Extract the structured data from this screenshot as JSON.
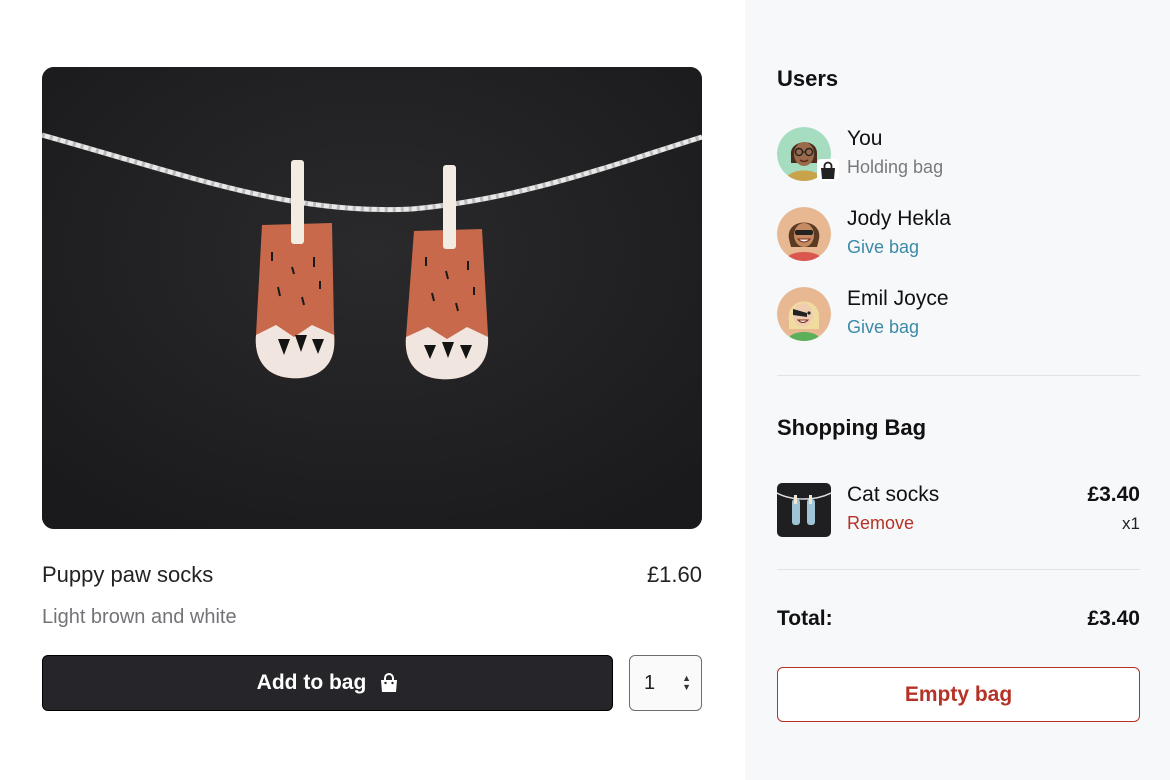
{
  "product": {
    "name": "Puppy paw socks",
    "price": "£1.60",
    "description": "Light brown and white",
    "image_icon": "socks-on-clothesline-image",
    "add_label": "Add to bag",
    "add_icon": "shopping-bag-icon",
    "quantity": "1"
  },
  "users": {
    "title": "Users",
    "list": [
      {
        "name": "You",
        "sub": "Holding bag",
        "avatar": "avatar-you",
        "badge": "lock-bag-icon"
      },
      {
        "name": "Jody Hekla",
        "sub": "Give bag",
        "avatar": "avatar-jody"
      },
      {
        "name": "Emil Joyce",
        "sub": "Give bag",
        "avatar": "avatar-emil"
      }
    ]
  },
  "bag": {
    "title": "Shopping Bag",
    "items": [
      {
        "name": "Cat socks",
        "remove_label": "Remove",
        "price": "£3.40",
        "qty": "x1"
      }
    ],
    "total_label": "Total:",
    "total_value": "£3.40",
    "empty_label": "Empty bag"
  },
  "colors": {
    "accent_link": "#3c8aa8",
    "danger": "#b53226",
    "button_dark": "#26262a",
    "sidebar_bg": "#f7f8fa"
  }
}
